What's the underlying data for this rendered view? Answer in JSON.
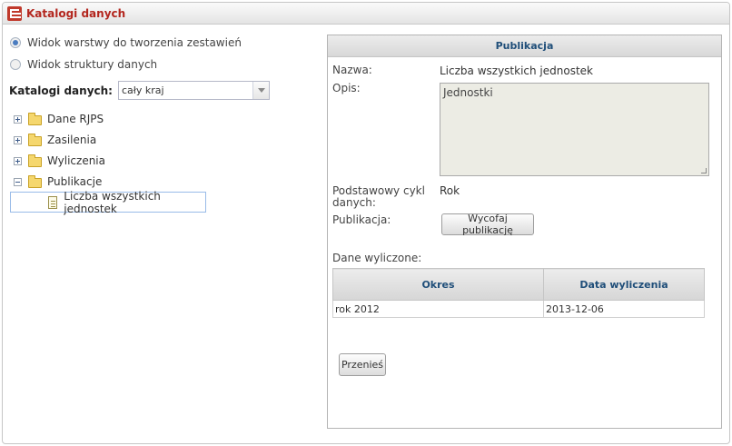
{
  "window": {
    "title": "Katalogi danych"
  },
  "view_options": [
    {
      "label": "Widok warstwy do tworzenia zestawień",
      "checked": true
    },
    {
      "label": "Widok struktury danych",
      "checked": false
    }
  ],
  "catalog": {
    "label": "Katalogi danych:",
    "value": "cały kraj"
  },
  "tree": {
    "folders": [
      {
        "label": "Dane RJPS",
        "expanded": false
      },
      {
        "label": "Zasilenia",
        "expanded": false
      },
      {
        "label": "Wyliczenia",
        "expanded": false
      },
      {
        "label": "Publikacje",
        "expanded": true
      }
    ],
    "selected_leaf": {
      "label": "Liczba wszystkich jednostek"
    }
  },
  "panel": {
    "header": "Publikacja",
    "name_label": "Nazwa:",
    "name_value": "Liczba wszystkich jednostek",
    "desc_label": "Opis:",
    "desc_value": "Jednostki",
    "cycle_label": "Podstawowy cykl danych:",
    "cycle_value": "Rok",
    "publication_label": "Publikacja:",
    "withdraw_button": "Wycofaj publikację",
    "computed_label": "Dane wyliczone:",
    "table": {
      "headers": [
        "Okres",
        "Data wyliczenia"
      ],
      "rows": [
        [
          "rok 2012",
          "2013-12-06"
        ]
      ]
    },
    "move_button": "Przenieś"
  }
}
